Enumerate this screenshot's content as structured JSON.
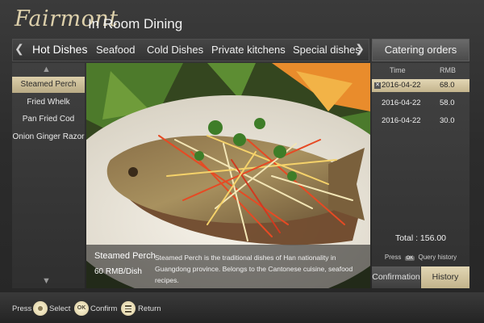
{
  "header": {
    "brand": "Fairmont",
    "title": "In Room Dining"
  },
  "tabs": {
    "prev_icon": "chevron-left-icon",
    "next_icon": "chevron-right-icon",
    "items": [
      {
        "label": "Hot Dishes",
        "active": true
      },
      {
        "label": "Seafood",
        "active": false
      },
      {
        "label": "Cold Dishes",
        "active": false
      },
      {
        "label": "Private kitchens",
        "active": false
      },
      {
        "label": "Special dishes",
        "active": false
      }
    ]
  },
  "sidebar": {
    "items": [
      {
        "label": "Steamed Perch",
        "active": true
      },
      {
        "label": "Fried Whelk",
        "active": false
      },
      {
        "label": "Pan Fried Cod",
        "active": false
      },
      {
        "label": "Onion Ginger Razor",
        "active": false
      }
    ]
  },
  "dish": {
    "name": "Steamed Perch",
    "price": "60 RMB/Dish",
    "description": "Steamed Perch is the traditional dishes of Han nationality in Guangdong province. Belongs to the Cantonese cuisine, seafood recipes."
  },
  "orders": {
    "title": "Catering orders",
    "col_time": "Time",
    "col_rmb": "RMB",
    "rows": [
      {
        "date": "2016-04-22",
        "amount": "68.0",
        "selected": true
      },
      {
        "date": "2016-04-22",
        "amount": "58.0",
        "selected": false
      },
      {
        "date": "2016-04-22",
        "amount": "30.0",
        "selected": false
      }
    ],
    "total": "Total : 156.00",
    "query_press": "Press",
    "query_key": "OK",
    "query_text": "Query history",
    "confirm_label": "Confirmation",
    "history_label": "History"
  },
  "footer": {
    "press": "Press",
    "select": "Select",
    "ok_key": "OK",
    "confirm": "Confirm",
    "return": "Return"
  },
  "colors": {
    "accent_gold": "#d7caa4",
    "panel": "#3a3a3a"
  }
}
